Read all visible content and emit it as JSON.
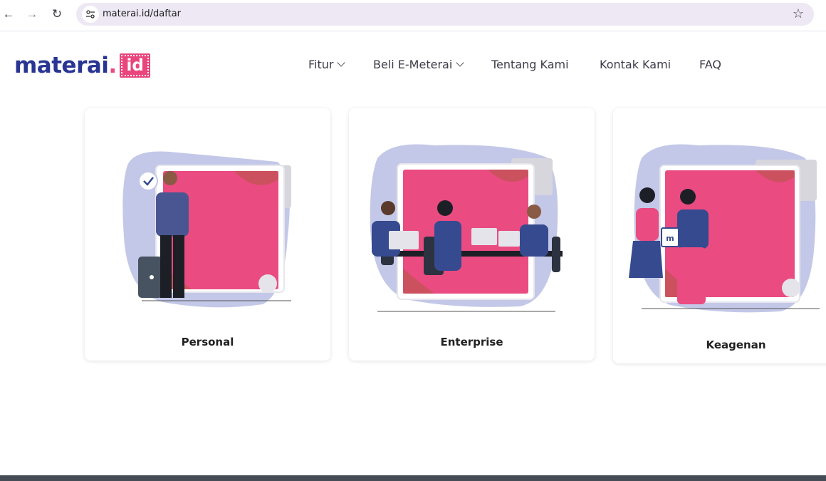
{
  "browser": {
    "url": "materai.id/daftar"
  },
  "header": {
    "logo_text": "materai",
    "logo_dot": ".",
    "logo_badge": "id",
    "nav": [
      {
        "label": "Fitur",
        "dropdown": true
      },
      {
        "label": "Beli E-Meterai",
        "dropdown": true
      },
      {
        "label": "Tentang Kami",
        "dropdown": false
      },
      {
        "label": "Kontak Kami",
        "dropdown": false
      },
      {
        "label": "FAQ",
        "dropdown": false
      }
    ]
  },
  "cards": [
    {
      "label": "Personal",
      "icon": "personal-illustration"
    },
    {
      "label": "Enterprise",
      "icon": "enterprise-illustration"
    },
    {
      "label": "Keagenan",
      "icon": "agency-illustration"
    }
  ],
  "colors": {
    "brand_blue": "#283593",
    "brand_pink": "#e8467c",
    "blob": "#c3c8e8",
    "footer": "#454c55"
  }
}
